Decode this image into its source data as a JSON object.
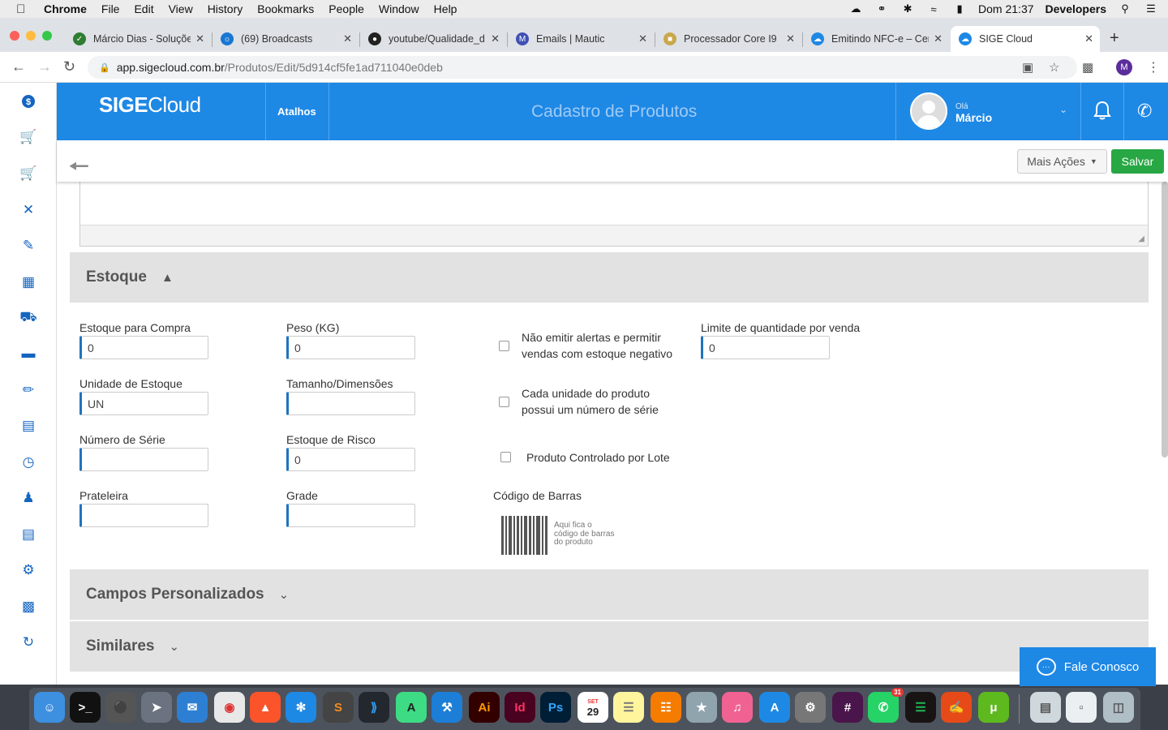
{
  "menubar": {
    "app": "Chrome",
    "items": [
      "File",
      "Edit",
      "View",
      "History",
      "Bookmarks",
      "People",
      "Window",
      "Help"
    ],
    "clock": "Dom 21:37",
    "user": "Developers"
  },
  "tabs": [
    {
      "title": "Márcio Dias - Soluçõe",
      "color": "#2e7d32",
      "icon": "check-shield-icon"
    },
    {
      "title": "(69) Broadcasts",
      "color": "#1976d2",
      "icon": "broadcast-icon"
    },
    {
      "title": "youtube/Qualidade_d",
      "color": "#222222",
      "icon": "github-icon"
    },
    {
      "title": "Emails | Mautic",
      "color": "#3f51b5",
      "icon": "mautic-icon"
    },
    {
      "title": "Processador Core I9 ",
      "color": "#c8a84b",
      "icon": "store-icon"
    },
    {
      "title": "Emitindo NFC-e – Cer",
      "color": "#1e88e5",
      "icon": "cloud-icon"
    },
    {
      "title": "SIGE Cloud",
      "color": "#1e88e5",
      "icon": "cloud-icon"
    }
  ],
  "address": {
    "host": "app.sigecloud.com.br",
    "path": "/Produtos/Edit/5d914cf5fe1ad711040e0deb",
    "profile_initial": "M"
  },
  "header": {
    "logo_sige": "SIGE",
    "logo_cloud": "Cloud",
    "shortcuts": "Atalhos",
    "title": "Cadastro de Produtos",
    "greeting": "Olá",
    "user": "Márcio"
  },
  "actions": {
    "more": "Mais Ações",
    "save": "Salvar"
  },
  "sections": {
    "stock": "Estoque",
    "custom_fields": "Campos Personalizados",
    "similar": "Similares"
  },
  "fields": {
    "estoque_compra": {
      "label": "Estoque para Compra",
      "value": "0"
    },
    "peso": {
      "label": "Peso (KG)",
      "value": "0"
    },
    "limite": {
      "label": "Limite de quantidade por venda",
      "value": "0"
    },
    "unidade": {
      "label": "Unidade de Estoque",
      "value": "UN"
    },
    "tamanho": {
      "label": "Tamanho/Dimensões",
      "value": ""
    },
    "numero_serie": {
      "label": "Número de Série",
      "value": ""
    },
    "estoque_risco": {
      "label": "Estoque de Risco",
      "value": "0"
    },
    "prateleira": {
      "label": "Prateleira",
      "value": ""
    },
    "grade": {
      "label": "Grade",
      "value": ""
    }
  },
  "checkboxes": {
    "alertas": {
      "line1": "Não emitir alertas e permitir",
      "line2": "vendas com estoque negativo",
      "checked": false
    },
    "serie": {
      "line1": "Cada unidade do produto",
      "line2": "possui um número de série",
      "checked": false
    },
    "lote": {
      "label": "Produto Controlado por Lote",
      "checked": false
    }
  },
  "barcode": {
    "label": "Código de Barras",
    "line1": "Aqui fica o",
    "line2": "código de barras",
    "line3": "do produto"
  },
  "chat": {
    "label": "Fale Conosco"
  },
  "dock": {
    "calendar_month": "SET",
    "calendar_day": "29",
    "whatsapp_badge": "31"
  },
  "colors": {
    "brand": "#1e88e5",
    "save": "#28a745",
    "sidebar_icons": "#1565c0"
  }
}
